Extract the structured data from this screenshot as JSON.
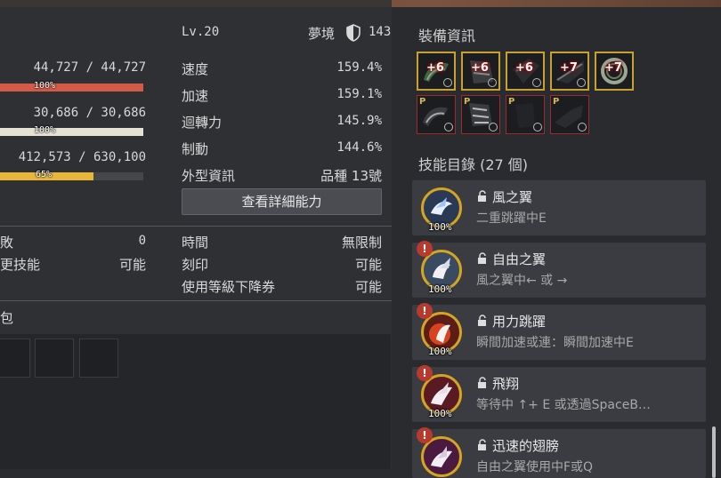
{
  "header": {
    "level": "Lv.20",
    "dream_label": "夢境",
    "dream_value": "143"
  },
  "bars": [
    {
      "value_text": "44,727 / 44,727",
      "percent_text": "100%",
      "fill_ratio": 1.0,
      "color": "#d35b46"
    },
    {
      "value_text": "30,686 / 30,686",
      "percent_text": "100%",
      "fill_ratio": 1.0,
      "color": "#e5e1d3"
    },
    {
      "value_text": "412,573 / 630,100",
      "percent_text": "65%",
      "fill_ratio": 0.65,
      "color": "#e8b63a"
    }
  ],
  "stats": [
    {
      "label": "速度",
      "value": "159.4%"
    },
    {
      "label": "加速",
      "value": "159.1%"
    },
    {
      "label": "迴轉力",
      "value": "145.9%"
    },
    {
      "label": "制動",
      "value": "144.6%"
    },
    {
      "label": "外型資訊",
      "value": "品種 13號"
    }
  ],
  "detail_button": "查看詳細能力",
  "left_rows": [
    {
      "label": "敗",
      "value": "0"
    },
    {
      "label": "更技能",
      "value": "可能"
    }
  ],
  "mid_rows": [
    {
      "label": "時間",
      "value": "無限制"
    },
    {
      "label": "刻印",
      "value": "可能"
    },
    {
      "label": "使用等級下降券",
      "value": "可能"
    }
  ],
  "bag_label": "包",
  "equipment": {
    "title": "裝備資訊",
    "top_row": [
      "+6",
      "+6",
      "+6",
      "+7",
      "+7"
    ],
    "bottom_row_marker": "P"
  },
  "skills": {
    "title": "技能目錄 (27 個)",
    "items": [
      {
        "name": "風之翼",
        "desc": "二重跳躍中E",
        "pct": "100%",
        "alert": false
      },
      {
        "name": "自由之翼",
        "desc": "風之翼中← 或 →",
        "pct": "100%",
        "alert": true
      },
      {
        "name": "用力跳躍",
        "desc": "瞬間加速或連：瞬間加速中E",
        "pct": "100%",
        "alert": true
      },
      {
        "name": "飛翔",
        "desc": "等待中 ↑+ E 或透過SpaceB…",
        "pct": "100%",
        "alert": true
      },
      {
        "name": "迅速的翅膀",
        "desc": "自由之翼使用中F或Q",
        "pct": "100%",
        "alert": true
      }
    ]
  },
  "alert_glyph": "!"
}
